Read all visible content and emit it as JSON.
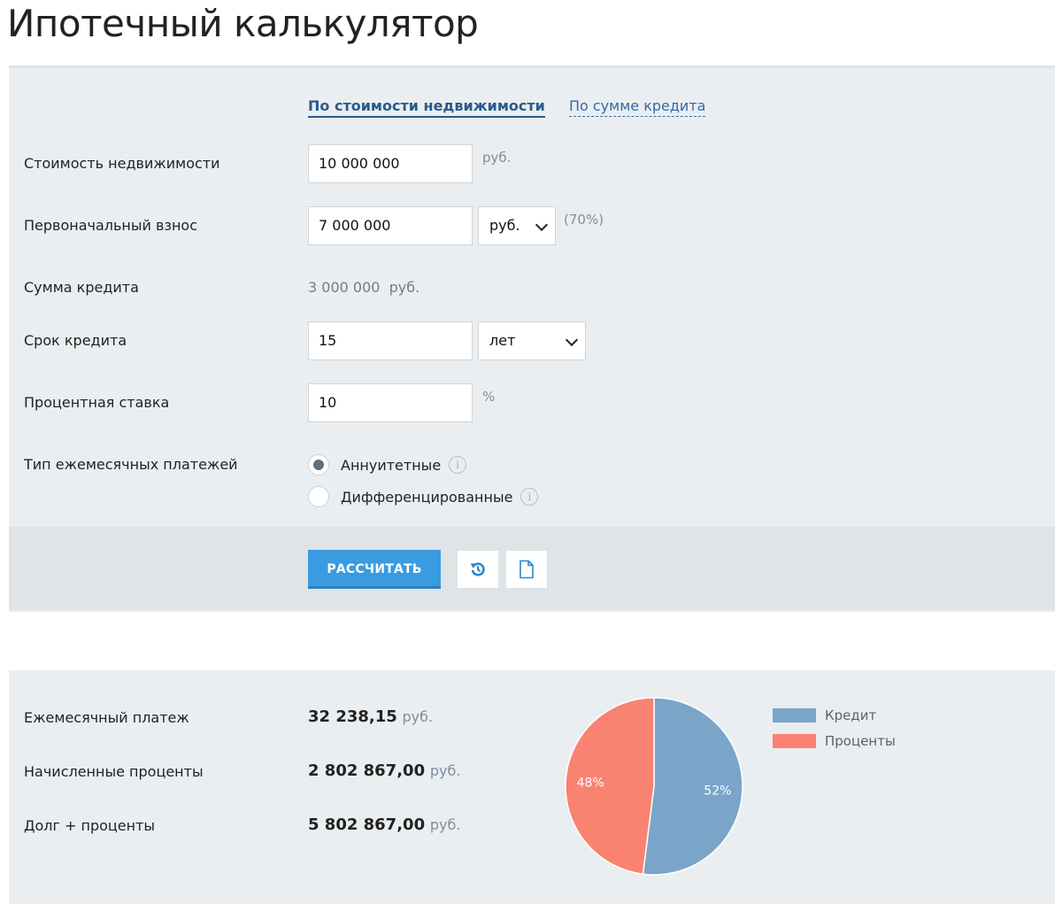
{
  "page_title": "Ипотечный калькулятор",
  "tabs": [
    {
      "label": "По стоимости недвижимости",
      "active": true
    },
    {
      "label": "По сумме кредита",
      "active": false
    }
  ],
  "fields": {
    "property_price": {
      "label": "Стоимость недвижимости",
      "value": "10 000 000",
      "unit": "руб."
    },
    "down_payment": {
      "label": "Первоначальный взнос",
      "value": "7 000 000",
      "select": "руб.",
      "percent": "(70%)"
    },
    "loan_amount": {
      "label": "Сумма кредита",
      "value": "3 000 000  руб."
    },
    "loan_term": {
      "label": "Срок кредита",
      "value": "15",
      "select": "лет"
    },
    "interest_rate": {
      "label": "Процентная ставка",
      "value": "10",
      "unit": "%"
    },
    "payment_type": {
      "label": "Тип ежемесячных платежей",
      "options": [
        {
          "label": "Аннуитетные",
          "checked": true
        },
        {
          "label": "Дифференцированные",
          "checked": false
        }
      ]
    }
  },
  "buttons": {
    "calculate": "РАССЧИТАТЬ",
    "reset_icon": "reset-icon",
    "document_icon": "document-icon"
  },
  "results": {
    "monthly_payment": {
      "label": "Ежемесячный платеж",
      "value": "32 238,15",
      "unit": "руб."
    },
    "accrued_interest": {
      "label": "Начисленные проценты",
      "value": "2 802 867,00",
      "unit": "руб."
    },
    "total": {
      "label": "Долг + проценты",
      "value": "5 802 867,00",
      "unit": "руб."
    }
  },
  "chart_data": {
    "type": "pie",
    "slices": [
      {
        "name": "Кредит",
        "value": 52,
        "label": "52%",
        "color": "#7aa5c9"
      },
      {
        "name": "Проценты",
        "value": 48,
        "label": "48%",
        "color": "#f98271"
      }
    ]
  },
  "colors": {
    "accent": "#3a9be0",
    "tab_active": "#285b8b",
    "panel_bg": "#ebeef0"
  }
}
